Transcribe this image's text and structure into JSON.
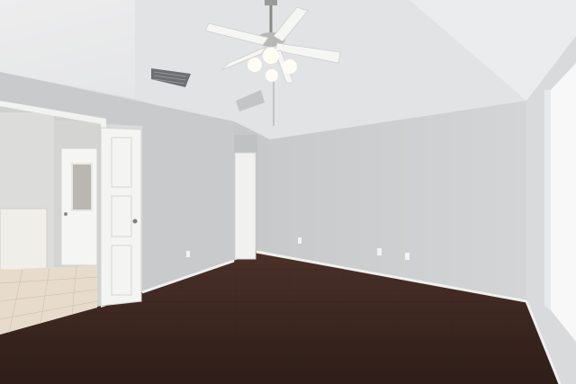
{
  "scene": {
    "colors": {
      "ceiling": "#e7e8ea",
      "ceiling_shadow": "#d6d8da",
      "wall_left": "#c9cbcc",
      "wall_back": "#cfd1d2",
      "wall_right": "#dddedf",
      "floor": "#3b2620",
      "baseboard": "#f1f1ef",
      "door": "#f4f4f2",
      "tile_floor": "#e6dccb",
      "window_glow": "#fafafa"
    },
    "icons": [
      "ceiling-fan-icon",
      "air-vent-icon",
      "light-bulb-icon",
      "door-knob-icon"
    ]
  }
}
